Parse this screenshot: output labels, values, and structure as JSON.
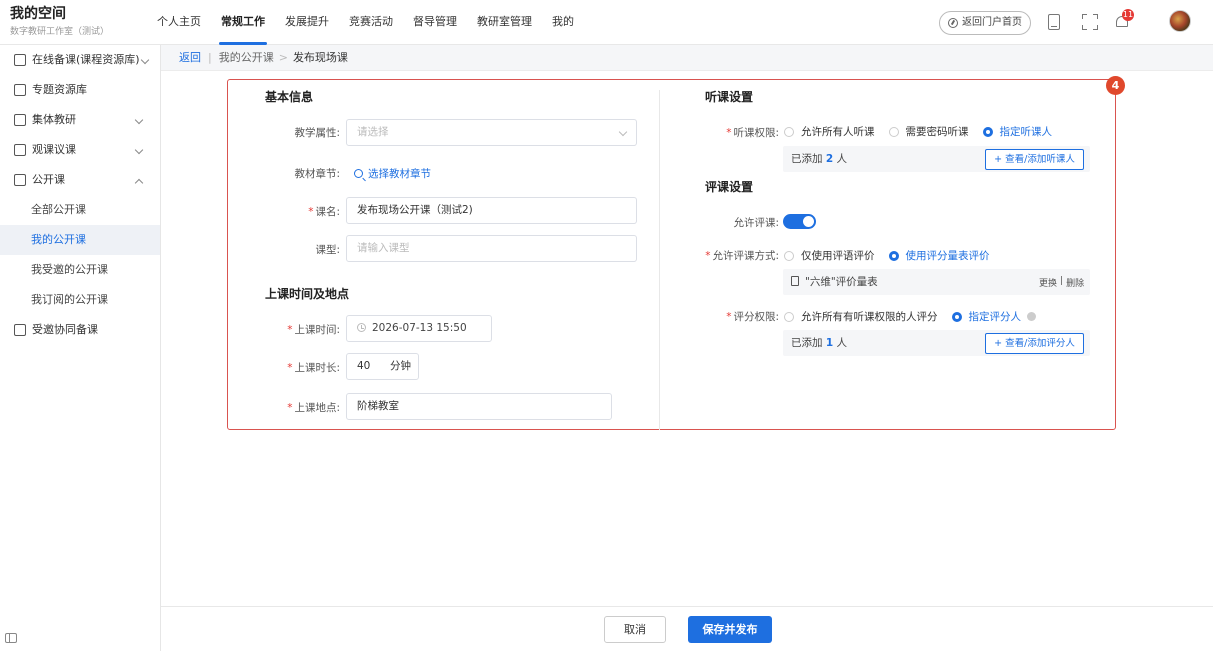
{
  "brand": {
    "title": "我的空间",
    "subtitle": "数字教研工作室（测试）"
  },
  "nav": [
    {
      "label": "个人主页"
    },
    {
      "label": "常规工作",
      "active": true
    },
    {
      "label": "发展提升"
    },
    {
      "label": "竞赛活动"
    },
    {
      "label": "督导管理"
    },
    {
      "label": "教研室管理"
    },
    {
      "label": "我的"
    }
  ],
  "header": {
    "portal_label": "返回门户首页",
    "notification_count": "11"
  },
  "sidebar": {
    "items": [
      {
        "label": "在线备课(课程资源库)",
        "icon": "lesson-icon"
      },
      {
        "label": "专题资源库",
        "icon": "resource-icon"
      },
      {
        "label": "集体教研",
        "icon": "research-icon"
      },
      {
        "label": "观课议课",
        "icon": "observe-icon"
      },
      {
        "label": "公开课",
        "icon": "openclass-icon"
      }
    ],
    "sub_items": [
      {
        "label": "全部公开课"
      },
      {
        "label": "我的公开课",
        "active": true
      },
      {
        "label": "我受邀的公开课"
      },
      {
        "label": "我订阅的公开课"
      }
    ],
    "extra": {
      "label": "受邀协同备课",
      "icon": "collab-icon"
    }
  },
  "breadcrumb": {
    "back": "返回",
    "parent": "我的公开课",
    "sep": ">",
    "current": "发布现场课"
  },
  "form": {
    "badge": "4",
    "basic": {
      "title": "基本信息",
      "attr_label": "教学属性:",
      "attr_placeholder": "请选择",
      "chapter_label": "教材章节:",
      "chapter_link": "选择教材章节",
      "name_label": "课名:",
      "name_value": "发布现场公开课（测试2)",
      "type_label": "课型:",
      "type_placeholder": "请输入课型"
    },
    "time": {
      "title": "上课时间及地点",
      "time_label": "上课时间:",
      "time_value": "2026-07-13 15:50",
      "duration_label": "上课时长:",
      "duration_value": "40",
      "duration_unit": "分钟",
      "place_label": "上课地点:",
      "place_value": "阶梯教室"
    },
    "listen": {
      "title": "听课设置",
      "perm_label": "听课权限:",
      "options": [
        "允许所有人听课",
        "需要密码听课",
        "指定听课人"
      ],
      "selected": 2,
      "added_prefix": "已添加",
      "added_count": "2",
      "added_suffix": "人",
      "view_btn": "+ 查看/添加听课人"
    },
    "review": {
      "title": "评课设置",
      "allow_label": "允许评课:",
      "allow_on": true,
      "mode_label": "允许评课方式:",
      "mode_options": [
        "仅使用评语评价",
        "使用评分量表评价"
      ],
      "mode_selected": 1,
      "scale_name": "\"六维\"评价量表",
      "scale_replace": "更换",
      "scale_sep": "|",
      "scale_delete": "删除",
      "score_label": "评分权限:",
      "score_options": [
        "允许所有有听课权限的人评分",
        "指定评分人"
      ],
      "score_selected": 1,
      "added_prefix": "已添加",
      "added_count": "1",
      "added_suffix": "人",
      "view_btn": "+ 查看/添加评分人"
    }
  },
  "footer": {
    "cancel": "取消",
    "save": "保存并发布"
  },
  "colors": {
    "accent": "#1e6fe0",
    "highlight": "#d9534f",
    "required": "#e53935"
  }
}
